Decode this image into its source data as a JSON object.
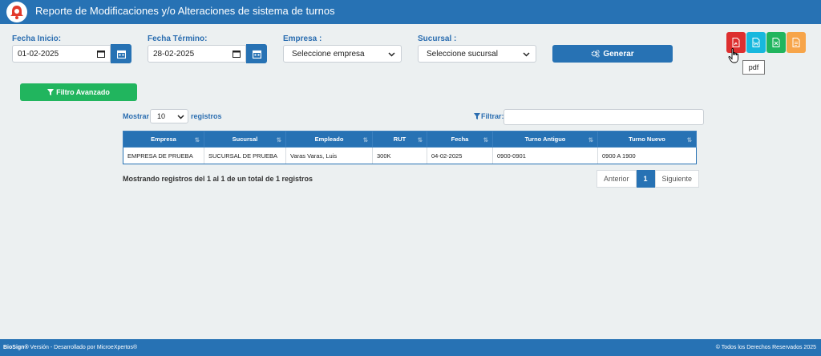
{
  "header": {
    "title": "Reporte de Modificaciones y/o Alteraciones de sistema de turnos",
    "logo": "biosign-logo-icon"
  },
  "filters": {
    "fecha_inicio": {
      "label": "Fecha Inicio:",
      "value": "01-02-2025"
    },
    "fecha_termino": {
      "label": "Fecha Término:",
      "value": "28-02-2025"
    },
    "empresa": {
      "label": "Empresa :",
      "selected": "Seleccione empresa"
    },
    "sucursal": {
      "label": "Sucursal :",
      "selected": "Seleccione sucursal"
    },
    "generar_label": "Generar"
  },
  "export": {
    "buttons": [
      {
        "name": "pdf",
        "color": "#dd2f2f"
      },
      {
        "name": "word",
        "color": "#17b8de"
      },
      {
        "name": "excel",
        "color": "#21b55e"
      },
      {
        "name": "csv",
        "color": "#f7a54a"
      }
    ],
    "tooltip": "pdf"
  },
  "filtro_avanzado_label": "Filtro Avanzado",
  "table_controls": {
    "mostrar": "Mostrar",
    "page_size": "10",
    "registros": "registros",
    "filtrar": "Filtrar:"
  },
  "table": {
    "columns": [
      "Empresa",
      "Sucursal",
      "Empleado",
      "RUT",
      "Fecha",
      "Turno Antiguo",
      "Turno Nuevo"
    ],
    "rows": [
      [
        "EMPRESA DE PRUEBA",
        "SUCURSAL DE PRUEBA",
        "Varas Varas, Luis",
        "300K",
        "04-02-2025",
        "0900-0901",
        "0900 A 1900"
      ]
    ]
  },
  "info": "Mostrando registros del 1 al 1 de un total de 1 registros",
  "pager": {
    "prev": "Anterior",
    "current": "1",
    "next": "Siguiente"
  },
  "footer": {
    "brand": "BioSign®",
    "left_rest": " Versión - Desarrollado por MicroeXpertos®",
    "right": "© Todos los Derechos Reservados 2025"
  },
  "colors": {
    "primary": "#2772b4",
    "success": "#21b55e",
    "background": "#ecf0f1"
  }
}
